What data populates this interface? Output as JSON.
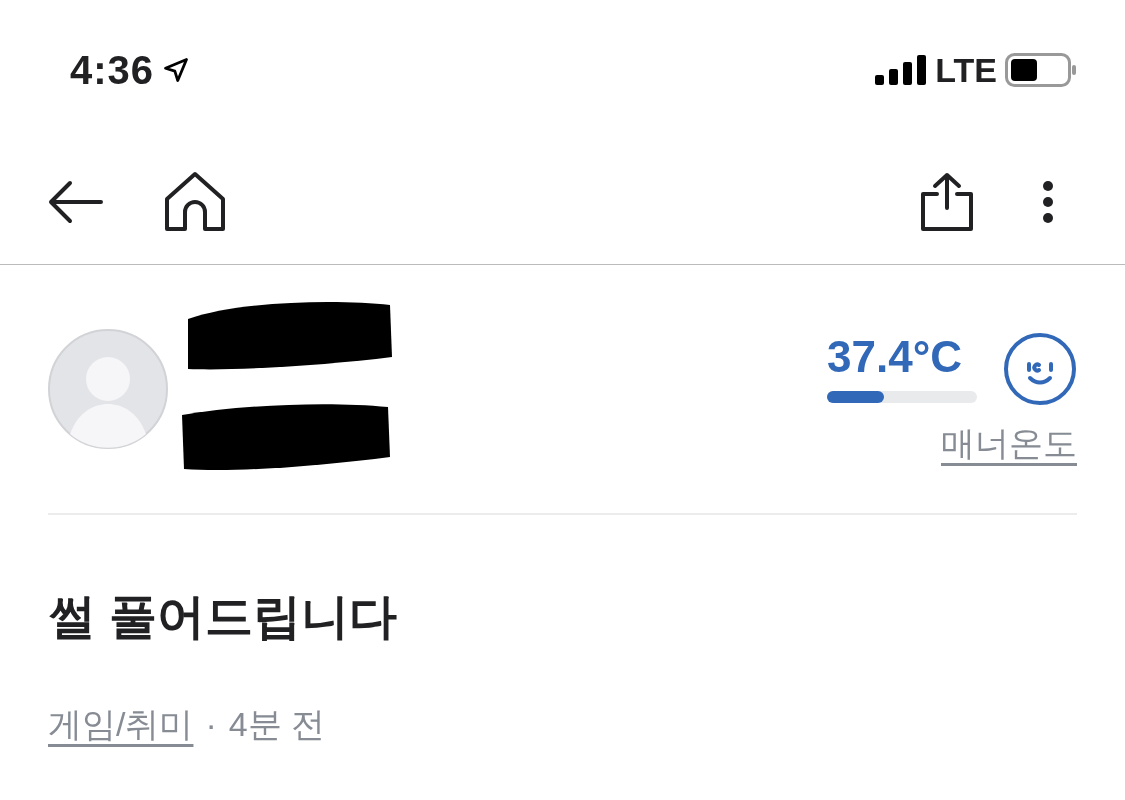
{
  "status_bar": {
    "time": "4:36",
    "network": "LTE"
  },
  "profile": {
    "temperature": "37.4°C",
    "level": 0.38,
    "manner_label": "매너온도"
  },
  "post": {
    "title": "썰 풀어드립니다",
    "category": "게임/취미",
    "separator": "·",
    "time": "4분 전"
  }
}
